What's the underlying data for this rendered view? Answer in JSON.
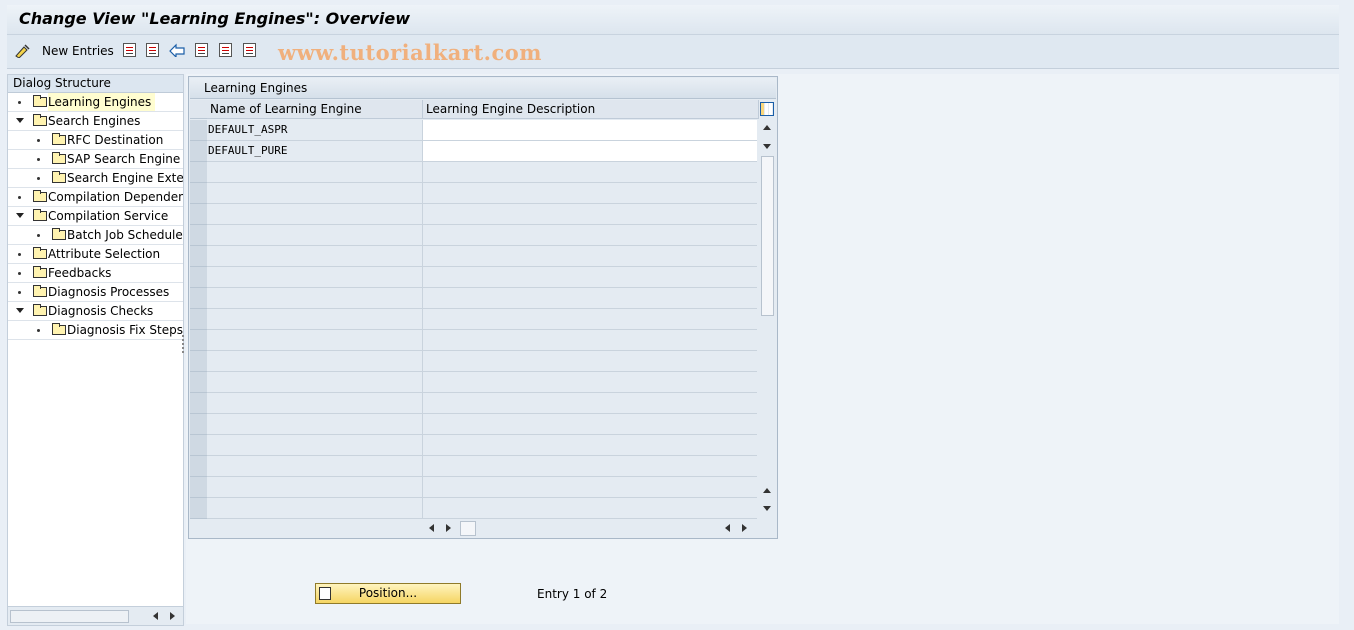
{
  "window": {
    "title": "Change View \"Learning Engines\": Overview"
  },
  "toolbar": {
    "new_entries_label": "New Entries",
    "icons": [
      "new-entries-icon",
      "copy-icon",
      "delete-icon",
      "undo-change-icon",
      "select-all-icon",
      "select-block-icon",
      "deselect-all-icon"
    ]
  },
  "watermark": "www.tutorialkart.com",
  "dialog_structure": {
    "header": "Dialog Structure",
    "items": [
      {
        "label": "Learning Engines",
        "level": 0,
        "expander": "bullet",
        "selected": true
      },
      {
        "label": "Search Engines",
        "level": 0,
        "expander": "expanded"
      },
      {
        "label": "RFC Destination",
        "level": 1,
        "expander": "bullet"
      },
      {
        "label": "SAP Search Engine",
        "level": 1,
        "expander": "bullet"
      },
      {
        "label": "Search Engine Exten",
        "level": 1,
        "expander": "bullet"
      },
      {
        "label": "Compilation Dependency",
        "level": 0,
        "expander": "bullet"
      },
      {
        "label": "Compilation Service",
        "level": 0,
        "expander": "expanded"
      },
      {
        "label": "Batch Job Schedule",
        "level": 1,
        "expander": "bullet"
      },
      {
        "label": "Attribute Selection",
        "level": 0,
        "expander": "bullet"
      },
      {
        "label": "Feedbacks",
        "level": 0,
        "expander": "bullet"
      },
      {
        "label": "Diagnosis Processes",
        "level": 0,
        "expander": "bullet"
      },
      {
        "label": "Diagnosis Checks",
        "level": 0,
        "expander": "expanded"
      },
      {
        "label": "Diagnosis Fix Steps",
        "level": 1,
        "expander": "bullet"
      }
    ]
  },
  "table": {
    "title": "Learning Engines",
    "columns": [
      "Name of Learning Engine",
      "Learning Engine Description"
    ],
    "rows": [
      [
        "DEFAULT_ASPR",
        ""
      ],
      [
        "DEFAULT_PURE",
        ""
      ]
    ],
    "empty_rows": 17
  },
  "footer": {
    "position_button_label": "Position...",
    "entry_text": "Entry 1 of 2"
  },
  "colors": {
    "background": "#e9eff6",
    "selected_tree_item": "#fffdd0",
    "button_yellow": "#f5d563",
    "watermark": "#f0b07d"
  }
}
